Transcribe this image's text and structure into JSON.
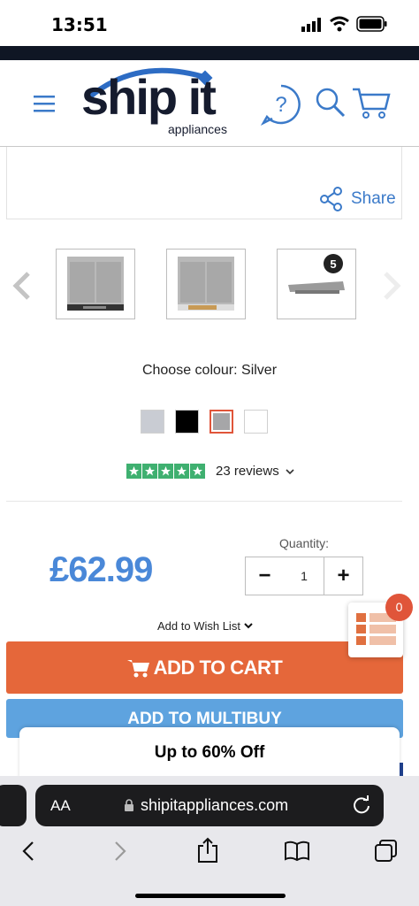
{
  "status_bar": {
    "time": "13:51"
  },
  "header": {
    "logo_main": "ship it",
    "logo_sub": "appliances",
    "icons": [
      "menu-icon",
      "help-icon",
      "search-icon",
      "cart-icon"
    ]
  },
  "product": {
    "share_label": "Share",
    "choose_colour_label": "Choose colour: Silver",
    "reviews_label": "23 reviews",
    "stars": 5,
    "price": "£62.99",
    "quantity_label": "Quantity:",
    "quantity_value": "1",
    "minus_label": "−",
    "plus_label": "+",
    "wish_list_label": "Add to Wish List",
    "add_to_cart_label": "ADD TO CART",
    "multibuy_label": "ADD TO MULTIBUY",
    "thumb3_badge": "5",
    "swatch_colors": [
      "#c9ccd3",
      "#000000",
      "#a6a6a8",
      "#ffffff"
    ]
  },
  "promo": {
    "text": "Up to 60% Off"
  },
  "floating_cart": {
    "count": "0"
  },
  "browser": {
    "aa_label": "AA",
    "url": "shipitappliances.com"
  },
  "colors": {
    "accent_orange": "#e5673a",
    "accent_blue": "#5ea3df",
    "price_blue": "#4a88d8",
    "dark_navy": "#0f1624"
  }
}
